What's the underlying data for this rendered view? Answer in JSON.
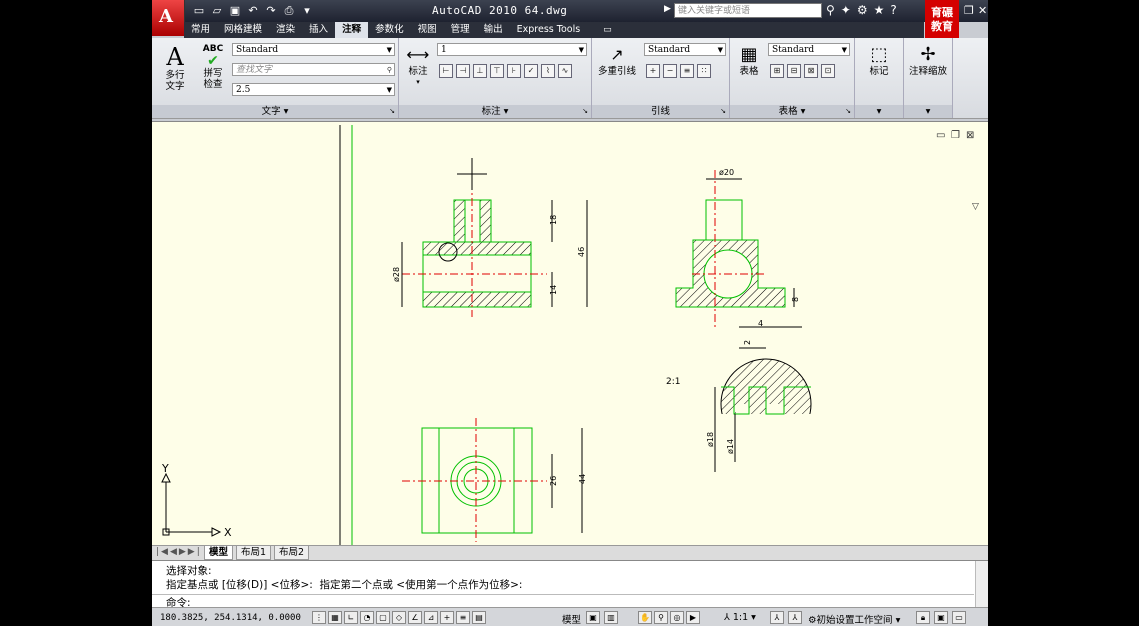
{
  "title": {
    "text": "AutoCAD 2010   64.dwg"
  },
  "search": {
    "placeholder": "键入关键字或短语"
  },
  "brand": {
    "line1": "育碾",
    "line2": "教育"
  },
  "tabs": [
    "常用",
    "网格建模",
    "渲染",
    "插入",
    "注释",
    "参数化",
    "视图",
    "管理",
    "输出",
    "Express Tools"
  ],
  "active_tab": "注释",
  "ribbon": {
    "text_panel": {
      "title": "文字",
      "multiline_label": "多行\n文字",
      "spell_label": "拼写\n检查",
      "style": "Standard",
      "find_placeholder": "查找文字",
      "height": "2.5"
    },
    "dim_panel": {
      "title": "标注",
      "dim_label": "标注",
      "style": "1"
    },
    "leader_panel": {
      "title": "引线",
      "multileader_label": "多重引线",
      "style": "Standard"
    },
    "table_panel": {
      "title": "表格",
      "table_label": "表格",
      "style": "Standard"
    },
    "mark_panel": {
      "mark_label": "标记"
    },
    "scale_panel": {
      "scale_label": "注释缩放"
    }
  },
  "drawing": {
    "dims": {
      "d28": "ø28",
      "d18": "18",
      "d46": "46",
      "d14": "14",
      "d20": "ø20",
      "d8": "8",
      "d4": "4",
      "d2": "2",
      "d18b": "ø18",
      "d14b": "ø14",
      "d26": "26",
      "d44": "44",
      "scale_note": "2:1"
    },
    "ucs_x": "X",
    "ucs_y": "Y"
  },
  "layout_tabs": [
    "模型",
    "布局1",
    "布局2"
  ],
  "command": {
    "line1": "选择对象:",
    "line2": "指定基点或 [位移(D)] <位移>:  指定第二个点或 <使用第一个点作为位移>:",
    "prompt": "命令:"
  },
  "status": {
    "coords": "180.3825, 254.1314, 0.0000",
    "model_label": "模型",
    "scale": "1:1",
    "workspace": "初始设置工作空间"
  },
  "colors": {
    "hatch": "#000000",
    "outline": "#00c000",
    "center": "#e00000"
  }
}
